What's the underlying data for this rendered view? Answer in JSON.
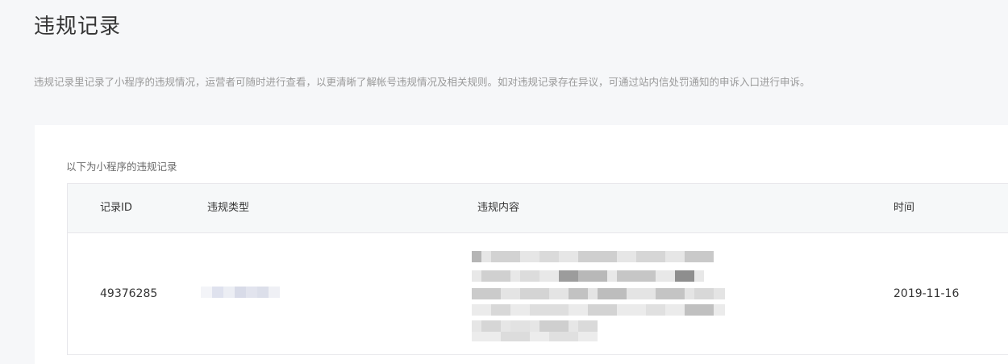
{
  "page": {
    "title": "违规记录",
    "description": "违规记录里记录了小程序的违规情况，运营者可随时进行查看，以更清晰了解帐号违规情况及相关规则。如对违规记录存在异议，可通过站内信处罚通知的申诉入口进行申诉。"
  },
  "records": {
    "caption": "以下为小程序的违规记录",
    "columns": [
      "记录ID",
      "违规类型",
      "违规内容",
      "时间"
    ],
    "rows": [
      {
        "id": "49376285",
        "type": "",
        "content": "",
        "time": "2019-11-16"
      }
    ]
  }
}
